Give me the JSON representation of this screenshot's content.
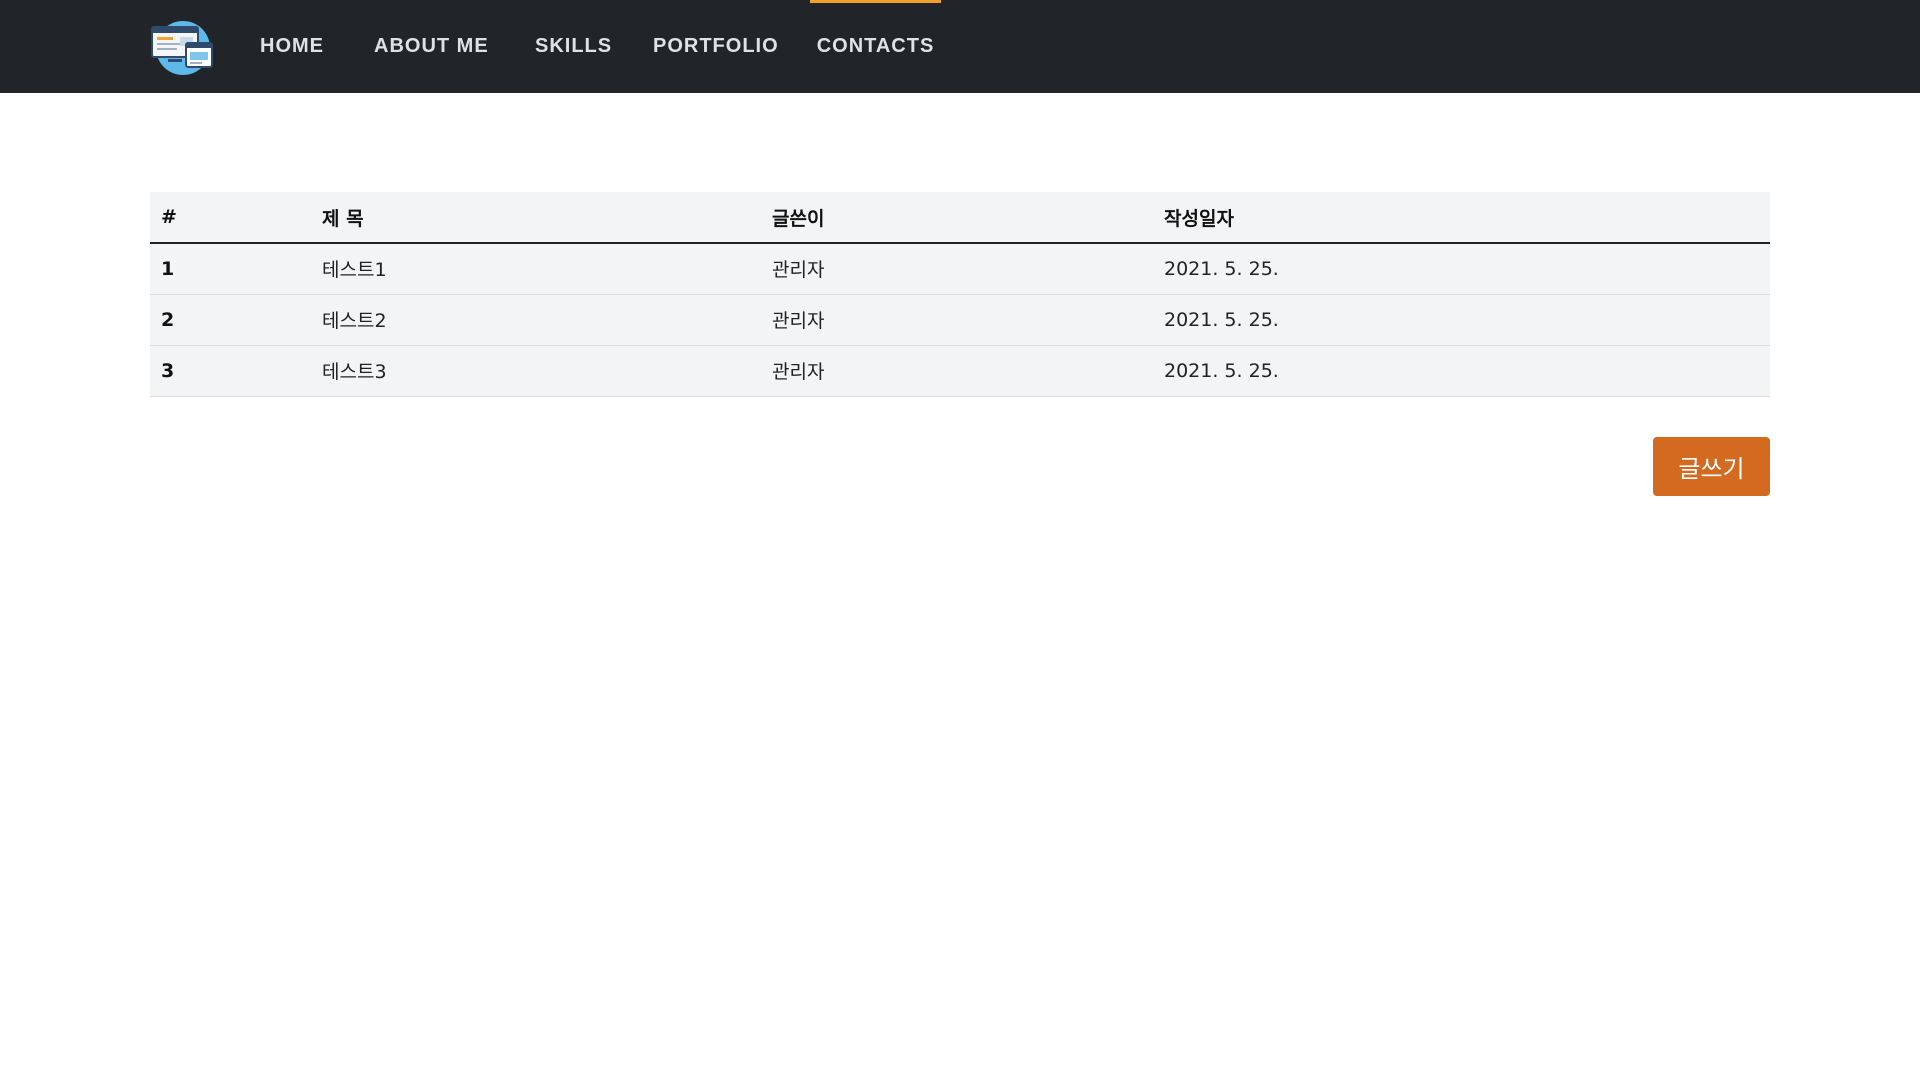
{
  "nav": {
    "logo_icon": "website-layout-icon",
    "items": [
      {
        "label": "HOME",
        "active": false
      },
      {
        "label": "ABOUT ME",
        "active": false
      },
      {
        "label": "SKILLS",
        "active": false
      },
      {
        "label": "PORTFOLIO",
        "active": false
      },
      {
        "label": "CONTACTS",
        "active": true
      }
    ],
    "active_color": "#f1a22a",
    "background": "#212529"
  },
  "board": {
    "columns": [
      "#",
      "제 목",
      "글쓴이",
      "작성일자"
    ],
    "rows": [
      {
        "num": "1",
        "title": "테스트1",
        "author": "관리자",
        "date": "2021. 5. 25."
      },
      {
        "num": "2",
        "title": "테스트2",
        "author": "관리자",
        "date": "2021. 5. 25."
      },
      {
        "num": "3",
        "title": "테스트3",
        "author": "관리자",
        "date": "2021. 5. 25."
      }
    ]
  },
  "write_button": {
    "label": "글쓰기",
    "color": "#d36a20"
  }
}
